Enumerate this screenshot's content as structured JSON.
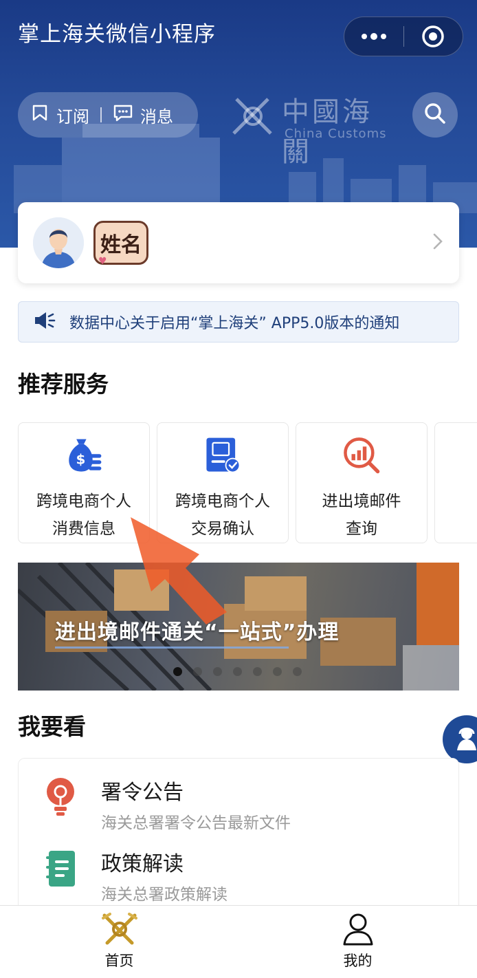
{
  "header": {
    "title": "掌上海关微信小程序",
    "capsule_more_icon": "more-dots-icon",
    "capsule_close_icon": "target-close-icon"
  },
  "quick_actions": {
    "subscribe_label": "订阅",
    "subscribe_icon": "bookmark-icon",
    "messages_label": "消息",
    "messages_icon": "chat-bubble-icon",
    "search_icon": "search-icon"
  },
  "logo": {
    "cn": "中國海關",
    "en": "China Customs"
  },
  "user": {
    "name_sticker": "姓名",
    "avatar_icon": "user-avatar-icon",
    "chevron_icon": "chevron-right-icon"
  },
  "notice": {
    "icon": "speaker-icon",
    "text": "数据中心关于启用“掌上海关” APP5.0版本的通知"
  },
  "recommended": {
    "title": "推荐服务",
    "items": [
      {
        "line1": "跨境电商个人",
        "line2": "消费信息",
        "icon": "money-bag-icon"
      },
      {
        "line1": "跨境电商个人",
        "line2": "交易确认",
        "icon": "document-check-icon"
      },
      {
        "line1": "进出境邮件",
        "line2": "查询",
        "icon": "chart-search-icon"
      }
    ]
  },
  "carousel": {
    "caption": "进出境邮件通关“一站式”办理",
    "slide_count": 7,
    "active_index": 0
  },
  "watch": {
    "title": "我要看",
    "items": [
      {
        "title": "署令公告",
        "subtitle": "海关总署署令公告最新文件",
        "icon": "lightbulb-icon"
      },
      {
        "title": "政策解读",
        "subtitle": "海关总署政策解读",
        "icon": "notebook-icon"
      }
    ]
  },
  "floating": {
    "icon": "customer-service-icon"
  },
  "tabbar": {
    "items": [
      {
        "label": "首页",
        "icon": "customs-emblem-icon",
        "active": true
      },
      {
        "label": "我的",
        "icon": "person-outline-icon",
        "active": false
      }
    ]
  },
  "colors": {
    "header_blue": "#1a3a86",
    "accent_blue": "#2b5fd9",
    "notice_bg": "#eef3fb",
    "icon_red": "#e05a45",
    "icon_green": "#3aa585"
  }
}
